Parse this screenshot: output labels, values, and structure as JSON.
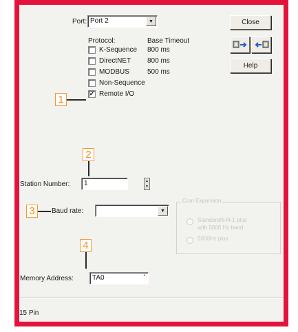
{
  "port": {
    "label": "Port:",
    "value": "Port 2"
  },
  "protocol": {
    "header": "Protocol:",
    "timeout_header": "Base Timeout",
    "items": [
      {
        "label": "K-Sequence",
        "checked": false,
        "timeout": "800 ms"
      },
      {
        "label": "DirectNET",
        "checked": false,
        "timeout": "800 ms"
      },
      {
        "label": "MODBUS",
        "checked": false,
        "timeout": "500 ms"
      },
      {
        "label": "Non-Sequence",
        "checked": false,
        "timeout": ""
      },
      {
        "label": "Remote I/O",
        "checked": true,
        "timeout": ""
      }
    ]
  },
  "buttons": {
    "close": "Close",
    "help": "Help"
  },
  "station": {
    "label": "Station Number:",
    "value": "1"
  },
  "baud": {
    "label": "Baud rate:",
    "value": ""
  },
  "memory": {
    "label": "Memory Address:",
    "value": "TA0"
  },
  "group": {
    "title": "Com Expansion",
    "opt1": "Standard/8-N-1 plus",
    "opt1b": "with 5000 Hz band",
    "opt2": "5000Hz plus"
  },
  "status": {
    "text": "15 Pin"
  },
  "callouts": [
    "1",
    "2",
    "3",
    "4"
  ],
  "colors": {
    "frame": "#e3133c",
    "callout": "#f28c1e",
    "dialog_bg": "#f2f2ee"
  }
}
